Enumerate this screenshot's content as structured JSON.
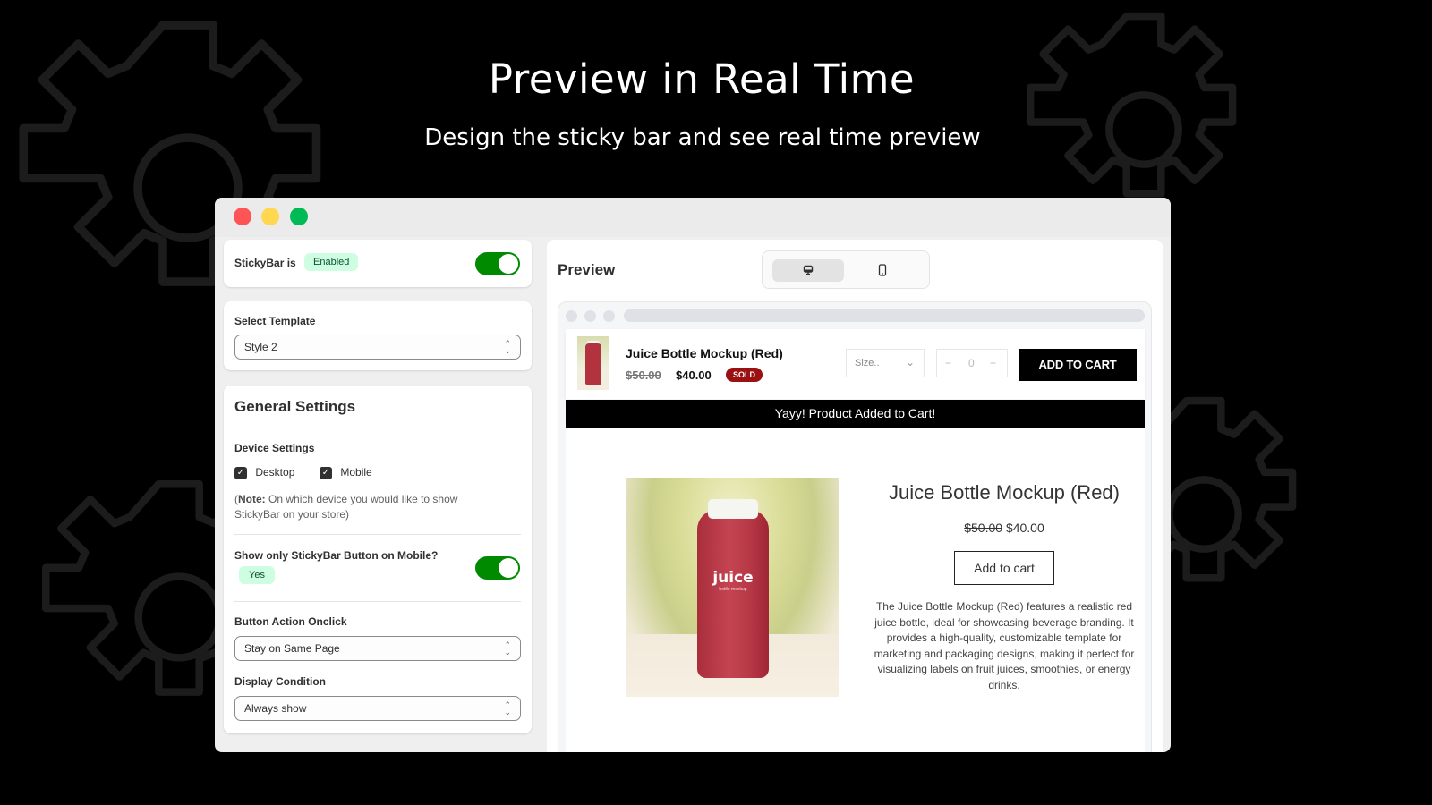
{
  "hero": {
    "title": "Preview in Real Time",
    "subtitle": "Design the sticky bar and see real time preview"
  },
  "window": {
    "controls": [
      "close",
      "minimize",
      "maximize"
    ]
  },
  "settings": {
    "status": {
      "label": "StickyBar is",
      "badge": "Enabled",
      "toggle_on": true
    },
    "template": {
      "label": "Select Template",
      "value": "Style 2"
    },
    "general": {
      "title": "General Settings",
      "device_settings_label": "Device Settings",
      "devices": [
        {
          "label": "Desktop",
          "checked": true
        },
        {
          "label": "Mobile",
          "checked": true
        }
      ],
      "note_bold": "Note:",
      "note_prefix": "(",
      "note_text": " On which device you would like to show StickyBar on your store)",
      "mobile_button_label": "Show only StickyBar Button on Mobile?",
      "mobile_button_badge": "Yes",
      "mobile_button_toggle_on": true,
      "button_action_label": "Button Action Onclick",
      "button_action_value": "Stay on Same Page",
      "display_condition_label": "Display Condition",
      "display_condition_value": "Always show"
    }
  },
  "preview": {
    "title": "Preview",
    "device_toggle": {
      "options": [
        "desktop",
        "mobile"
      ],
      "active": "desktop"
    },
    "sticky_bar": {
      "product_name": "Juice Bottle Mockup (Red)",
      "compare_price": "$50.00",
      "price": "$40.00",
      "badge": "SOLD",
      "size_placeholder": "Size..",
      "qty_minus": "−",
      "qty_value": "0",
      "qty_plus": "+",
      "cta": "ADD TO CART",
      "notification": "Yayy! Product Added to Cart!"
    },
    "product": {
      "image_brand": "juice",
      "image_sub": "bottle mockup",
      "title": "Juice Bottle Mockup (Red)",
      "compare_price": "$50.00",
      "price": "$40.00",
      "add_to_cart": "Add to cart",
      "description": "The Juice Bottle Mockup (Red) features a realistic red juice bottle, ideal for showcasing beverage branding. It provides a high-quality, customizable template for marketing and packaging designs, making it perfect for visualizing labels on fruit juices, smoothies, or energy drinks."
    }
  },
  "colors": {
    "background": "#000000",
    "gear_outline": "#1c1c1c",
    "toggle_on": "#008a00",
    "badge_bg": "#cdfee1",
    "sold_badge": "#9b1111"
  }
}
